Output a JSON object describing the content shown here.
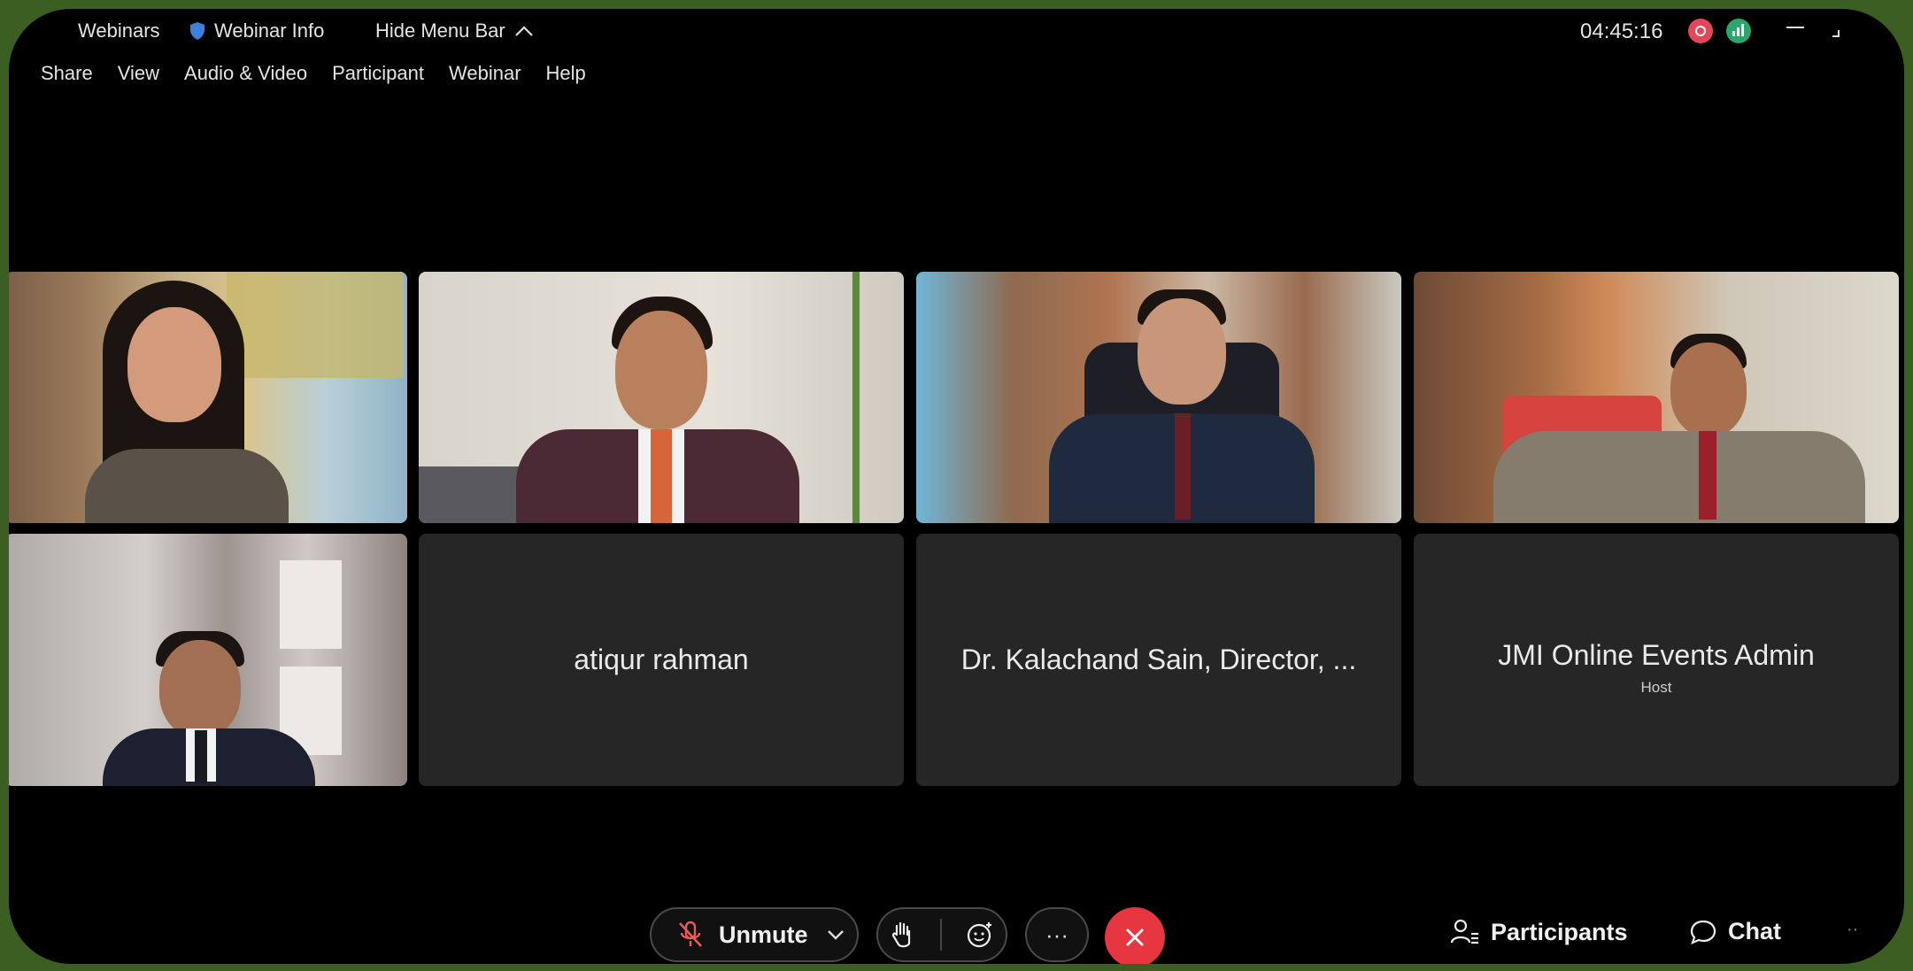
{
  "titlebar": {
    "webinars_label": "Webinars",
    "webinar_info_label": "Webinar Info",
    "hide_menu_label": "Hide Menu Bar",
    "timer": "04:45:16"
  },
  "menu": {
    "share": "Share",
    "view": "View",
    "audio_video": "Audio & Video",
    "participant": "Participant",
    "webinar": "Webinar",
    "help": "Help"
  },
  "tiles": {
    "atiqur": {
      "name": "atiqur rahman"
    },
    "kalachand": {
      "name": "Dr. Kalachand Sain, Director, ..."
    },
    "jmi": {
      "name": "JMI Online Events Admin",
      "role": "Host"
    }
  },
  "controls": {
    "unmute_label": "Unmute",
    "more_label": "···",
    "participants_label": "Participants",
    "chat_label": "Chat"
  },
  "colors": {
    "accent_red": "#e6363f",
    "record_red": "#e4475a",
    "stats_green": "#2aa86b",
    "frame_green": "#3b5e22"
  },
  "icons": [
    "shield-icon",
    "chevron-up-icon",
    "record-icon",
    "stats-icon",
    "muted-mic-icon",
    "chevron-down-icon",
    "raise-hand-icon",
    "reaction-icon",
    "close-icon",
    "participants-icon",
    "chat-icon"
  ]
}
